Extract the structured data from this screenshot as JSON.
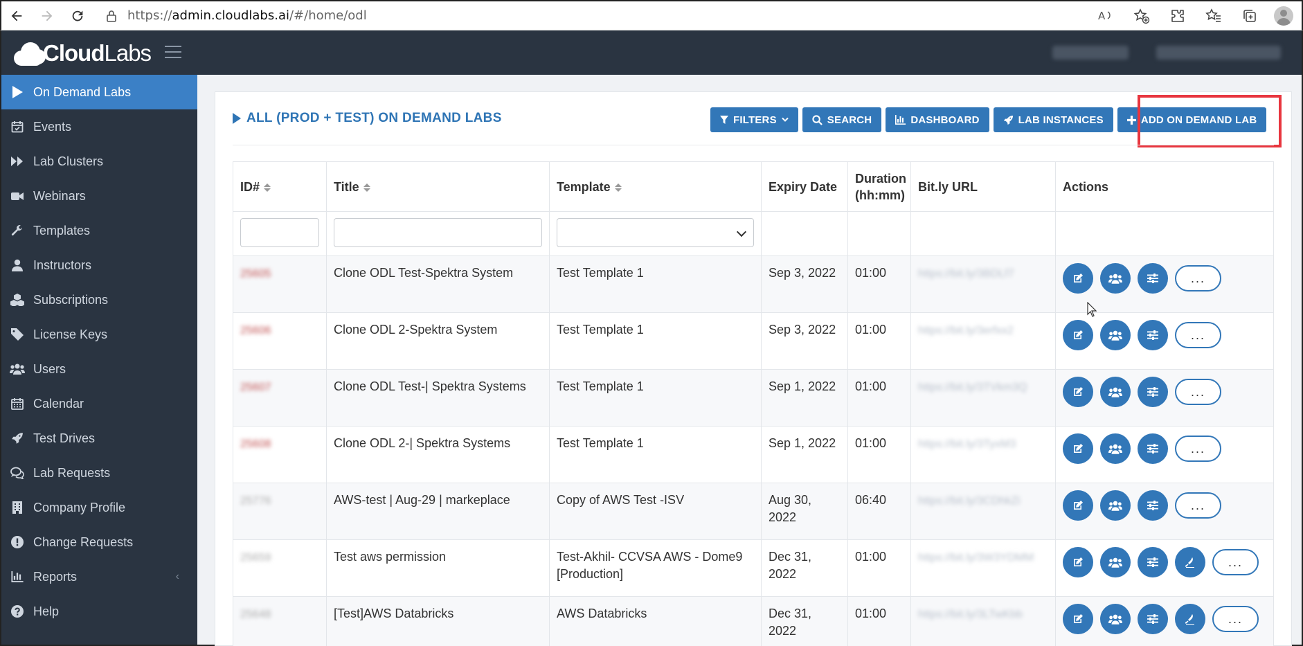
{
  "browser": {
    "url_prefix": "https://",
    "url_domain": "admin.cloudlabs.ai",
    "url_path": "/#/home/odl"
  },
  "header": {
    "logo_word1": "Cloud",
    "logo_word2": "Labs"
  },
  "sidebar": {
    "items": [
      {
        "label": "On Demand Labs",
        "icon": "play-icon",
        "active": true
      },
      {
        "label": "Events",
        "icon": "calendar-check-icon"
      },
      {
        "label": "Lab Clusters",
        "icon": "fast-forward-icon"
      },
      {
        "label": "Webinars",
        "icon": "video-camera-icon"
      },
      {
        "label": "Templates",
        "icon": "wrench-icon"
      },
      {
        "label": "Instructors",
        "icon": "user-icon"
      },
      {
        "label": "Subscriptions",
        "icon": "cubes-icon"
      },
      {
        "label": "License Keys",
        "icon": "tag-icon"
      },
      {
        "label": "Users",
        "icon": "users-icon"
      },
      {
        "label": "Calendar",
        "icon": "calendar-icon"
      },
      {
        "label": "Test Drives",
        "icon": "rocket-icon"
      },
      {
        "label": "Lab Requests",
        "icon": "comments-icon"
      },
      {
        "label": "Company Profile",
        "icon": "building-icon"
      },
      {
        "label": "Change Requests",
        "icon": "exclamation-circle-icon"
      },
      {
        "label": "Reports",
        "icon": "bar-chart-icon"
      },
      {
        "label": "Help",
        "icon": "question-circle-icon"
      }
    ]
  },
  "main": {
    "title": "ALL (PROD + TEST) ON DEMAND LABS",
    "toolbar": {
      "filters": "FILTERS",
      "search": "SEARCH",
      "dashboard": "DASHBOARD",
      "lab_instances": "LAB INSTANCES",
      "add_lab": "ADD ON DEMAND LAB"
    },
    "columns": {
      "id": "ID#",
      "title": "Title",
      "template": "Template",
      "expiry": "Expiry Date",
      "duration_1": "Duration",
      "duration_2": "(hh:mm)",
      "bitly": "Bit.ly URL",
      "actions": "Actions"
    },
    "more_label": "...",
    "rows": [
      {
        "id": "25605",
        "title": "Clone ODL Test-Spektra System",
        "template": "Test Template 1",
        "expiry": "Sep 3, 2022",
        "duration": "01:00",
        "url": "https://bit.ly/3BDLf7"
      },
      {
        "id": "25606",
        "title": "Clone ODL 2-Spektra System",
        "template": "Test Template 1",
        "expiry": "Sep 3, 2022",
        "duration": "01:00",
        "url": "https://bit.ly/3erfxx2"
      },
      {
        "id": "25607",
        "title": "Clone ODL Test-| Spektra Systems",
        "template": "Test Template 1",
        "expiry": "Sep 1, 2022",
        "duration": "01:00",
        "url": "https://bit.ly/3TVkm3Q"
      },
      {
        "id": "25608",
        "title": "Clone ODL 2-| Spektra Systems",
        "template": "Test Template 1",
        "expiry": "Sep 1, 2022",
        "duration": "01:00",
        "url": "https://bit.ly/3TyxM3"
      },
      {
        "id": "25776",
        "title": "AWS-test | Aug-29 | markeplace",
        "template": "Copy of AWS Test -ISV",
        "expiry": "Aug 30, 2022",
        "duration": "06:40",
        "url": "https://bit.ly/3CDhkZi"
      },
      {
        "id": "25659",
        "title": "Test aws permission",
        "template": "Test-Akhil- CCVSA AWS - Dome9 [Production]",
        "expiry": "Dec 31, 2022",
        "duration": "01:00",
        "url": "https://bit.ly/3W3YDMM"
      },
      {
        "id": "25648",
        "title": "[Test]AWS Databricks",
        "template": "AWS Databricks",
        "expiry": "Dec 31, 2022",
        "duration": "01:00",
        "url": "https://bit.ly/3LTwKbb"
      }
    ]
  },
  "colors": {
    "primary": "#3277b8",
    "sidebar_bg": "#2a3441",
    "sidebar_active": "#3b80c6",
    "highlight": "#e8363f"
  }
}
